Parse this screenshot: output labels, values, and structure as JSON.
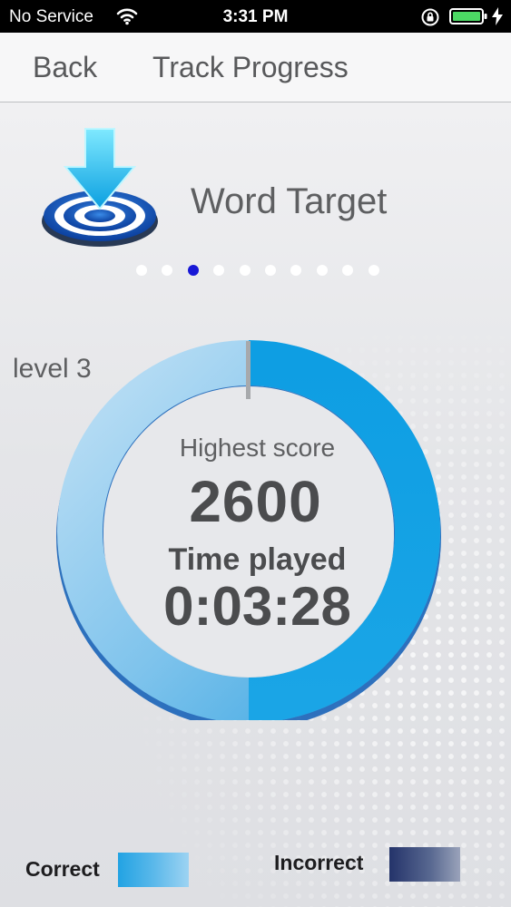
{
  "status_bar": {
    "carrier": "No Service",
    "time": "3:31 PM"
  },
  "nav": {
    "back_label": "Back",
    "title": "Track Progress"
  },
  "game": {
    "name": "Word Target",
    "icon": "target-arrow-icon"
  },
  "pager": {
    "page_count": 10,
    "active_index": 2
  },
  "progress": {
    "level_label": "level 3",
    "highest_score_label": "Highest score",
    "highest_score_value": "2600",
    "time_played_label": "Time played",
    "time_played_value": "0:03:28",
    "ring_fraction_bright": 0.5
  },
  "legend": {
    "correct_label": "Correct",
    "incorrect_label": "Incorrect"
  },
  "colors": {
    "correct": "#22a3e3",
    "correct_light": "#a9d6f2",
    "incorrect": "#24336a",
    "pager_active": "#1818d6"
  }
}
